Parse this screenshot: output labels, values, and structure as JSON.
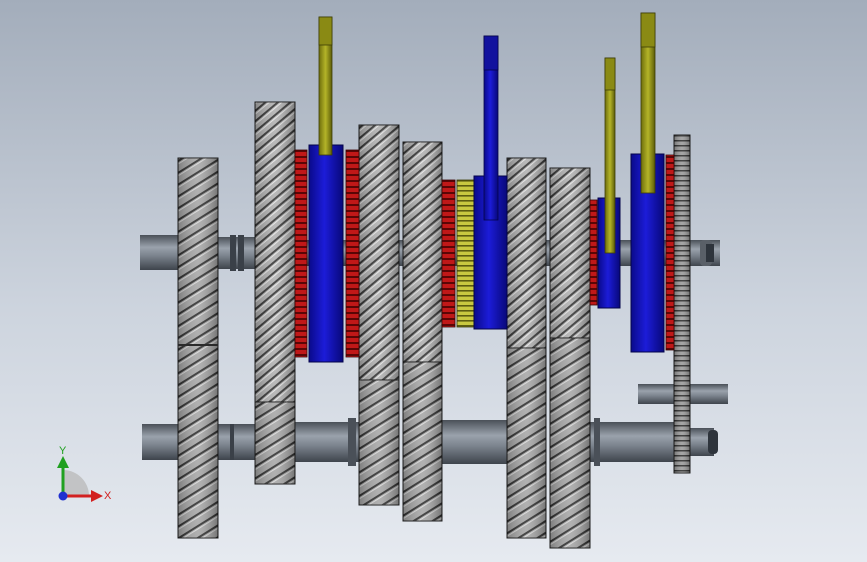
{
  "view": {
    "background_top": "#a3adbb",
    "background_bottom": "#e6eaf0"
  },
  "colors": {
    "gear_steel": "#8c8c8c",
    "shaft": "#6e747c",
    "synchronizer": "#1515c8",
    "shift_fork": "#a8a81a",
    "clutch_ring": "#b01010"
  },
  "triad": {
    "x_label": "X",
    "y_label": "Y",
    "x_color": "#d22020",
    "y_color": "#20a020",
    "z_color": "#2030d0"
  }
}
